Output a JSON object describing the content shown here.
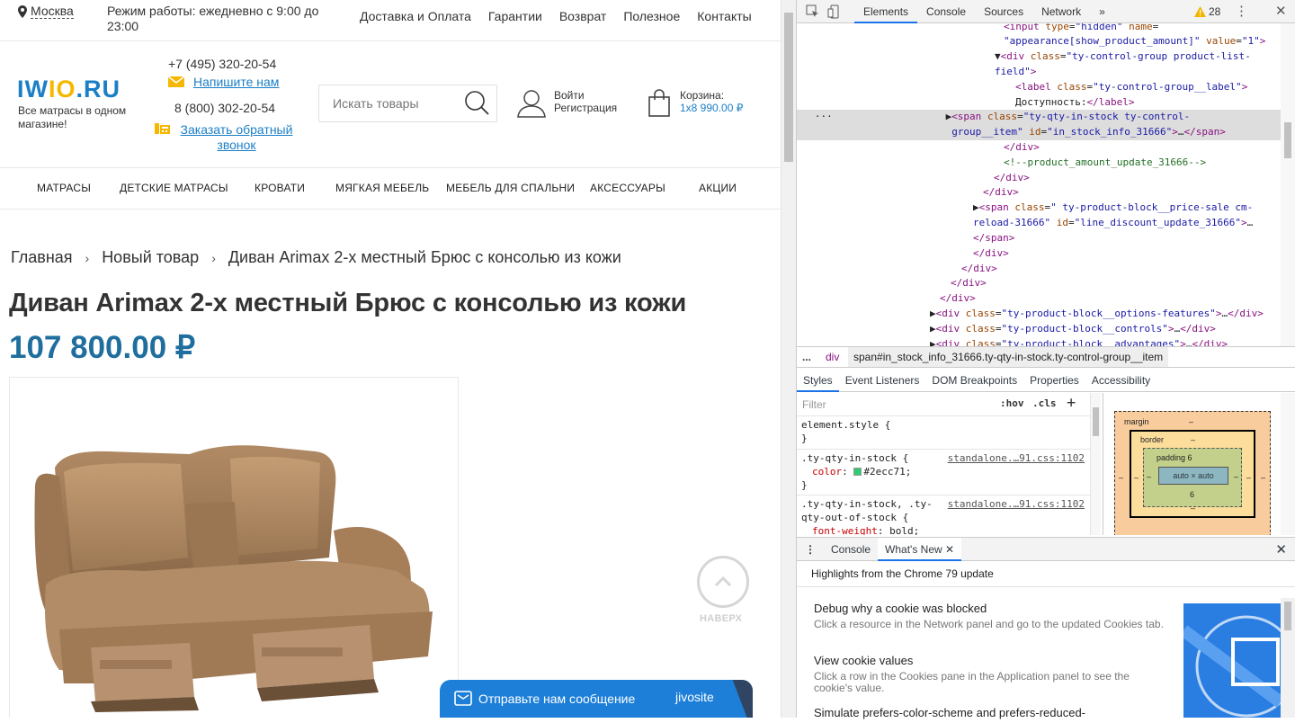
{
  "site": {
    "city": "Москва",
    "hours": "Режим работы: ежедневно с 9:00 до 23:00",
    "topnav": [
      "Доставка и Оплата",
      "Гарантии",
      "Возврат",
      "Полезное",
      "Контакты"
    ],
    "logo_a": "IW",
    "logo_b": "IO",
    "logo_c": ".RU",
    "logo_sub": "Все матрасы в одном магазине!",
    "phone1": "+7 (495) 320-20-54",
    "write_us": "Напишите нам",
    "phone2": "8 (800) 302-20-54",
    "callback": "Заказать обратный звонок",
    "search_placeholder": "Искать товары",
    "login": "Войти",
    "register": "Регистрация",
    "cart_label": "Корзина:",
    "cart_value": "1x8 990.00 ₽",
    "mainnav": [
      "МАТРАСЫ",
      "ДЕТСКИЕ МАТРАСЫ",
      "КРОВАТИ",
      "МЯГКАЯ МЕБЕЛЬ",
      "МЕБЕЛЬ ДЛЯ СПАЛЬНИ",
      "АКСЕССУАРЫ",
      "АКЦИИ"
    ],
    "breadcrumbs": [
      "Главная",
      "Новый товар",
      "Диван Arimax 2-х местный Брюс с консолью из кожи"
    ],
    "crumb_sep": "›",
    "title": "Диван Arimax 2-х местный Брюс с консолью из кожи",
    "price": "107 800.00 ₽",
    "to_top": "НАВЕРХ",
    "jivo_message": "Отправьте нам сообщение",
    "jivo_brand": "jivosite",
    "colors": {
      "brand_blue": "#1b7fc6",
      "brand_yellow": "#f5b700",
      "price": "#1f6e9e",
      "jivo": "#1d7fd8"
    }
  },
  "devtools": {
    "tabs": [
      "Elements",
      "Console",
      "Sources",
      "Network"
    ],
    "more_tabs": "»",
    "active_tab": "Elements",
    "warnings": "28",
    "crumbs": {
      "ellipsis": "...",
      "tag": "div",
      "selected": "span#in_stock_info_31666.ty-qty-in-stock.ty-control-group__item"
    },
    "sub_tabs": [
      "Styles",
      "Event Listeners",
      "DOM Breakpoints",
      "Properties",
      "Accessibility"
    ],
    "filter_placeholder": "Filter",
    "hov": ":hov",
    "cls": ".cls",
    "plus": "+",
    "styles": {
      "element_style": "element.style {",
      "close": "}",
      "rule1_selector": ".ty-qty-in-stock {",
      "rule1_source": "standalone.…91.css:1102",
      "rule1_prop": "color",
      "rule1_value": "#2ecc71;",
      "rule2_selector": ".ty-qty-in-stock, .ty-",
      "rule2_selector2": "qty-out-of-stock {",
      "rule2_source": "standalone.…91.css:1102",
      "rule2_prop": "font-weight",
      "rule2_value": "bold;"
    },
    "box": {
      "margin": "margin",
      "border": "border",
      "padding": "padding 6",
      "content": "auto × auto",
      "dash": "–",
      "pad_bottom": "6"
    },
    "drawer_tabs": [
      "Console",
      "What's New"
    ],
    "whatsnew_head": "Highlights from the Chrome 79 update",
    "whatsnew": [
      {
        "h": "Debug why a cookie was blocked",
        "d": "Click a resource in the Network panel and go to the updated Cookies tab."
      },
      {
        "h": "View cookie values",
        "d": "Click a row in the Cookies pane in the Application panel to see the cookie's value."
      },
      {
        "h": "Simulate prefers-color-scheme and prefers-reduced-",
        "d": ""
      }
    ]
  }
}
